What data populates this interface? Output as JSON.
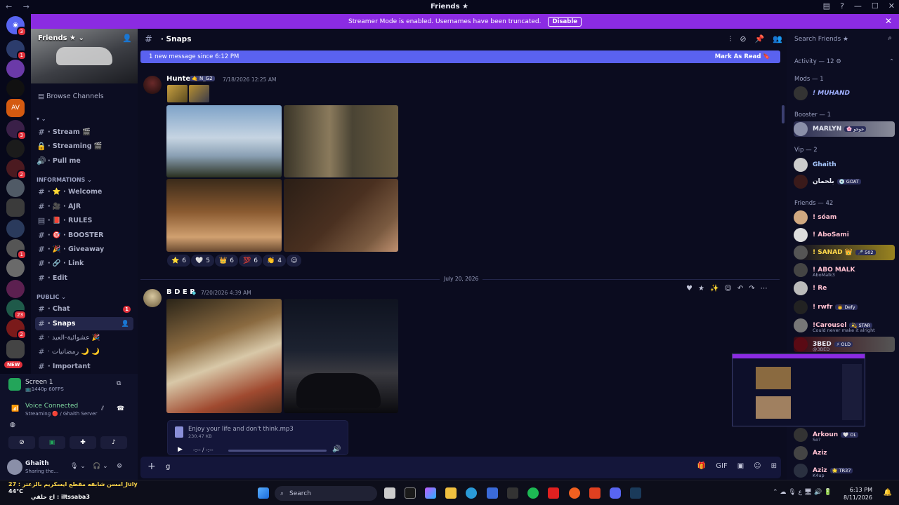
{
  "window": {
    "title": "Friends ★"
  },
  "banner": {
    "text": "Streamer Mode is enabled. Usernames have been truncated.",
    "button": "Disable"
  },
  "rail": {
    "badges": [
      "3",
      "1",
      "3",
      "2",
      "1",
      "23",
      "2"
    ],
    "new_label": "NEW"
  },
  "server": {
    "name": "Friends ★ ⌄",
    "browse": "Browse Channels"
  },
  "channels": {
    "top": [
      {
        "icon": "#",
        "label": "· Stream 🎬"
      },
      {
        "icon": "🔒",
        "label": "· Streaming 🎬"
      },
      {
        "icon": "🔊",
        "label": "· Pull me"
      }
    ],
    "cat_info": "INFORMATIONS ⌄",
    "info": [
      {
        "icon": "#",
        "label": "· ⭐ · Welcome"
      },
      {
        "icon": "#",
        "label": "· 🎥 · AJR"
      },
      {
        "icon": "#",
        "label": "· 📕 · RULES"
      },
      {
        "icon": "#",
        "label": "· 🎯 · BOOSTER"
      },
      {
        "icon": "#",
        "label": "· 🎉 · Giveaway"
      },
      {
        "icon": "#",
        "label": "· 🔗 · Link"
      },
      {
        "icon": "#",
        "label": "· Edit"
      }
    ],
    "cat_public": "PUBLIC ⌄",
    "public": [
      {
        "icon": "#",
        "label": "· Chat",
        "badge": "1"
      },
      {
        "icon": "#",
        "label": "· Snaps"
      },
      {
        "icon": "#",
        "label": "· عشوائية-العيد 🎉"
      },
      {
        "icon": "#",
        "label": "· رمضانيات 🌙 🌙"
      },
      {
        "icon": "#",
        "label": "· Important"
      }
    ]
  },
  "voice": {
    "screen": "Screen 1",
    "screen_sub": "📺1440p 60FPS",
    "connected": "Voice Connected",
    "server": "Streaming 🔴 / Ghaith Server",
    "user": "Ghaith",
    "user_status": "Sharing the..."
  },
  "chat": {
    "channel": "· Snaps",
    "new_since": "1 new message since 6:12 PM",
    "mark_read": "Mark As Read 🔖",
    "msg1": {
      "author": "Hunter",
      "tag": "🤙 N_G2",
      "time": "7/18/2026 12:25 AM"
    },
    "reactions": [
      {
        "emoji": "⭐",
        "count": "6"
      },
      {
        "emoji": "🤍",
        "count": "5"
      },
      {
        "emoji": "👑",
        "count": "6"
      },
      {
        "emoji": "💯",
        "count": "6"
      },
      {
        "emoji": "👏",
        "count": "4"
      },
      {
        "emoji": "☺",
        "count": ""
      }
    ],
    "date_divider": "July 20, 2026",
    "msg2": {
      "author": "B D E R",
      "time": "7/20/2026 4:39 AM"
    },
    "audio": {
      "name": "Enjoy your life and don't think.mp3",
      "size": "230.47 KB",
      "time": "-:-- / -:--"
    },
    "composer_text": "g"
  },
  "members": {
    "search": "Search Friends ★",
    "activity": "Activity — 12 ⚙",
    "cat_mods": "Mods — 1",
    "mods": [
      {
        "name": "! MUHAND"
      }
    ],
    "cat_booster": "Booster — 1",
    "boosters": [
      {
        "name": "MARLYN",
        "tag": "🌸 جوجو"
      }
    ],
    "cat_vip": "Vip — 2",
    "vips": [
      {
        "name": "Ghaith"
      },
      {
        "name": "بلحمان",
        "tag": "💿 GOAT"
      }
    ],
    "cat_friends": "Friends — 42",
    "friends": [
      {
        "name": "! sóam"
      },
      {
        "name": "! AboSami"
      },
      {
        "name": "! SANAD 👑",
        "tag": "🎤 502"
      },
      {
        "name": "! ABO MALK",
        "sub": "AboMalk3"
      },
      {
        "name": "! Re"
      },
      {
        "name": "! rwfr",
        "tag": "👨 Defy"
      },
      {
        "name": "!Carousel",
        "tag": "💫 STAR",
        "sub": "Could never make it alright"
      },
      {
        "name": "3BED",
        "tag": "⚡ OLD",
        "sub": "@3BED"
      },
      {
        "name": "Arkoun",
        "tag": "🤍 OL",
        "sub": "So?"
      },
      {
        "name": "Aziz"
      },
      {
        "name": "Aziz",
        "tag": "🌟 TR37",
        "sub": "K4up"
      }
    ]
  },
  "taskbar": {
    "search": "Search",
    "time": "6:13 PM",
    "date": "8/11/2026",
    "ticker1": "امسن شابفه مقطع ايسكريم بالزعتر : 27_July",
    "ticker2": "اخ حلقي : iltssaba3",
    "temp": "44°C"
  },
  "colors": {
    "accent": "#8b2be2",
    "new_bar": "#5a62f0",
    "bg": "#0b0c1f"
  }
}
